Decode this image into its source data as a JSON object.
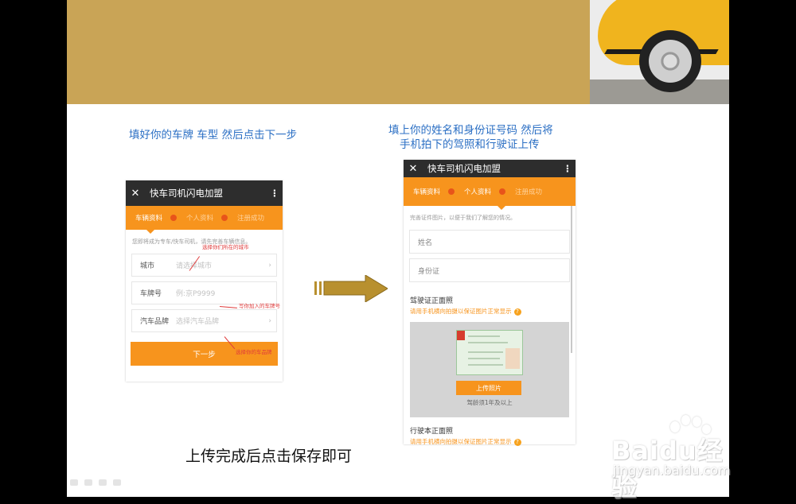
{
  "captions": {
    "left": "填好你的车牌 车型  然后点击下一步",
    "right_line1": "填上你的姓名和身份证号码 然后将",
    "right_line2": "手机拍下的驾照和行驶证上传",
    "bottom": "上传完成后点击保存即可"
  },
  "app": {
    "title": "快车司机闪电加盟",
    "close_glyph": "✕",
    "more_glyph": "⋮",
    "steps": [
      "车辆资料",
      "个人资料",
      "注册成功"
    ]
  },
  "phone1": {
    "hint": "您即将成为专车/快车司机，请先完善车辆信息。",
    "fields": [
      {
        "label": "城市",
        "placeholder": "请选择城市"
      },
      {
        "label": "车牌号",
        "placeholder": "例:京P9999"
      },
      {
        "label": "汽车品牌",
        "placeholder": "选择汽车品牌"
      }
    ],
    "next_button": "下一步",
    "annotations": [
      "选择你们所在的城市",
      "写你加入的车牌号",
      "选择你的车品牌"
    ]
  },
  "phone2": {
    "hint": "完善证件图片，以便于我们了解您的情况。",
    "name_placeholder": "姓名",
    "id_placeholder": "身份证",
    "license_title": "驾驶证正面照",
    "license_hint": "请用手机横向拍摄以保证图片正常显示",
    "upload_button": "上传照片",
    "upload_note": "驾龄须1年及以上",
    "vehicle_title": "行驶本正面照",
    "vehicle_hint": "请用手机横向拍摄以保证图片正常显示",
    "help_glyph": "?"
  },
  "watermark": {
    "brand": "Baidu经验",
    "site": "jingyan.baidu.com"
  },
  "colors": {
    "accent": "#f7941d",
    "caption": "#2b6fc4",
    "banner": "#c9a456",
    "annotation": "#e03b3b"
  }
}
